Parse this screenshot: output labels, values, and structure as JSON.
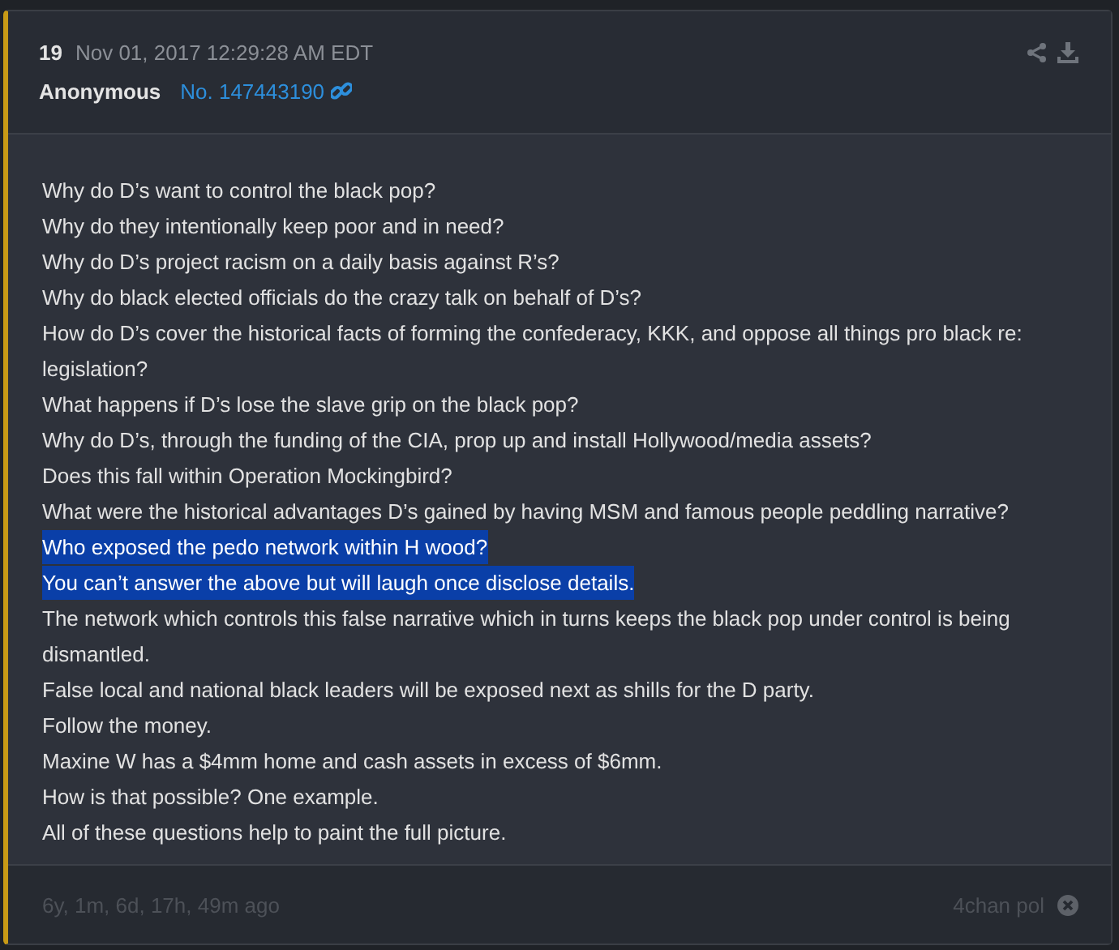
{
  "post": {
    "number": "19",
    "timestamp": "Nov 01, 2017 12:29:28 AM EDT",
    "author": "Anonymous",
    "post_id": "No. 147443190",
    "lines": [
      {
        "text": "Why do D’s want to control the black pop?",
        "selected": false
      },
      {
        "text": "Why do they intentionally keep poor and in need?",
        "selected": false
      },
      {
        "text": "Why do D’s project racism on a daily basis against R’s?",
        "selected": false
      },
      {
        "text": "Why do black elected officials do the crazy talk on behalf of D’s?",
        "selected": false
      },
      {
        "text": "How do D’s cover the historical facts of forming the confederacy, KKK, and oppose all things pro black re: legislation?",
        "selected": false
      },
      {
        "text": "What happens if D’s lose the slave grip on the black pop?",
        "selected": false
      },
      {
        "text": "Why do D’s, through the funding of the CIA, prop up and install Hollywood/media assets?",
        "selected": false
      },
      {
        "text": "Does this fall within Operation Mockingbird?",
        "selected": false
      },
      {
        "text": "What were the historical advantages D’s gained by having MSM and famous people peddling narrative?",
        "selected": false
      },
      {
        "text": "Who exposed the pedo network within H wood?",
        "selected": true
      },
      {
        "text": "You can’t answer the above but will laugh once disclose details.",
        "selected": true
      },
      {
        "text": "The network which controls this false narrative which in turns keeps the black pop under control is being dismantled.",
        "selected": false
      },
      {
        "text": "False local and national black leaders will be exposed next as shills for the D party.",
        "selected": false
      },
      {
        "text": "Follow the money.",
        "selected": false
      },
      {
        "text": "Maxine W has a $4mm home and cash assets in excess of $6mm.",
        "selected": false
      },
      {
        "text": "How is that possible? One example.",
        "selected": false
      },
      {
        "text": "All of these questions help to paint the full picture.",
        "selected": false
      }
    ],
    "age": "6y, 1m, 6d, 17h, 49m ago",
    "source": "4chan pol"
  }
}
